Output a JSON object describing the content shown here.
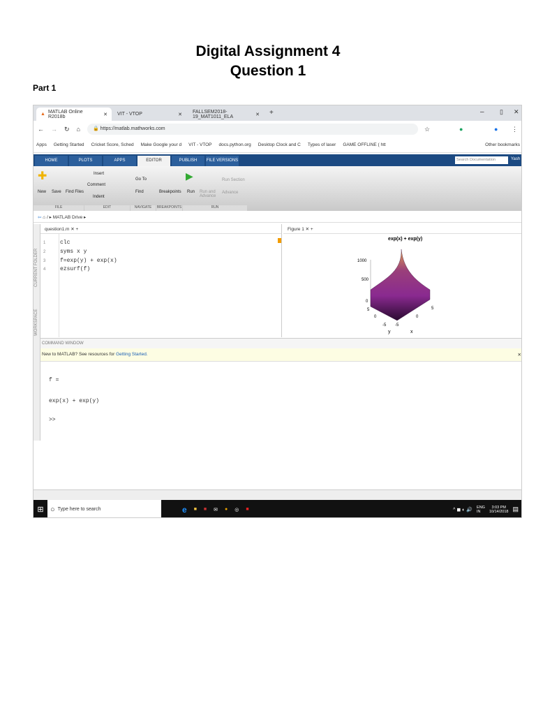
{
  "document": {
    "title": "Digital Assignment 4",
    "subtitle": "Question 1",
    "section": "Part 1"
  },
  "browser": {
    "tabs": [
      {
        "label": "MATLAB Online R2018b"
      },
      {
        "label": "VIT - VTOP"
      },
      {
        "label": "FALLSEM2018-19_MAT1011_ELA"
      }
    ],
    "url": "https://matlab.mathworks.com",
    "bookmarks": [
      "Apps",
      "Getting Started",
      "Cricket Score, Sched",
      "Make Google your d",
      "VIT - VTOP",
      "docs.python.org",
      "Desktop Clock and C",
      "Types of laser",
      "GAME OFFLINE ( htt"
    ],
    "other_bookmarks": "Other bookmarks"
  },
  "matlab": {
    "tabs": [
      "HOME",
      "PLOTS",
      "APPS",
      "EDITOR",
      "PUBLISH",
      "FILE VERSIONS"
    ],
    "search_placeholder": "Search Documentation",
    "user": "Yash",
    "ribbon": {
      "new": "New",
      "save": "Save",
      "find_files": "Find Files",
      "insert": "Insert",
      "comment": "Comment",
      "indent": "Indent",
      "goto": "Go To",
      "find": "Find",
      "breakpoints": "Breakpoints",
      "run": "Run",
      "run_advance": "Run and Advance",
      "run_section": "Run Section",
      "advance": "Advance"
    },
    "groups": [
      "FILE",
      "EDIT",
      "NAVIGATE",
      "BREAKPOINTS",
      "RUN"
    ],
    "path": "MATLAB Drive",
    "side_labels": [
      "CURRENT FOLDER",
      "WORKSPACE"
    ],
    "editor_tab": "question1.m",
    "code": [
      {
        "n": "1",
        "text": "clc"
      },
      {
        "n": "2",
        "text": "syms x y"
      },
      {
        "n": "3",
        "text": "f=exp(y) + exp(x)"
      },
      {
        "n": "4",
        "text": "ezsurf(f)"
      }
    ],
    "figure_tab": "Figure 1",
    "command_window": "COMMAND WINDOW",
    "notice": "New to MATLAB? See resources for",
    "notice_link": "Getting Started.",
    "output": [
      "f =",
      "exp(x) + exp(y)",
      ">>"
    ]
  },
  "chart_data": {
    "type": "surface",
    "title": "exp(x) + exp(y)",
    "xlabel": "x",
    "ylabel": "y",
    "zticks": [
      "0",
      "500",
      "1000"
    ],
    "xticks": [
      "-5",
      "0",
      "5"
    ],
    "yticks": [
      "5",
      "0",
      "-5"
    ],
    "zlim": [
      0,
      1100
    ],
    "xlim": [
      -6.3,
      6.3
    ],
    "ylim": [
      -6.3,
      6.3
    ]
  },
  "taskbar": {
    "search": "Type here to search",
    "lang": "ENG",
    "region": "IN",
    "time": "3:03 PM",
    "date": "10/14/2018"
  }
}
